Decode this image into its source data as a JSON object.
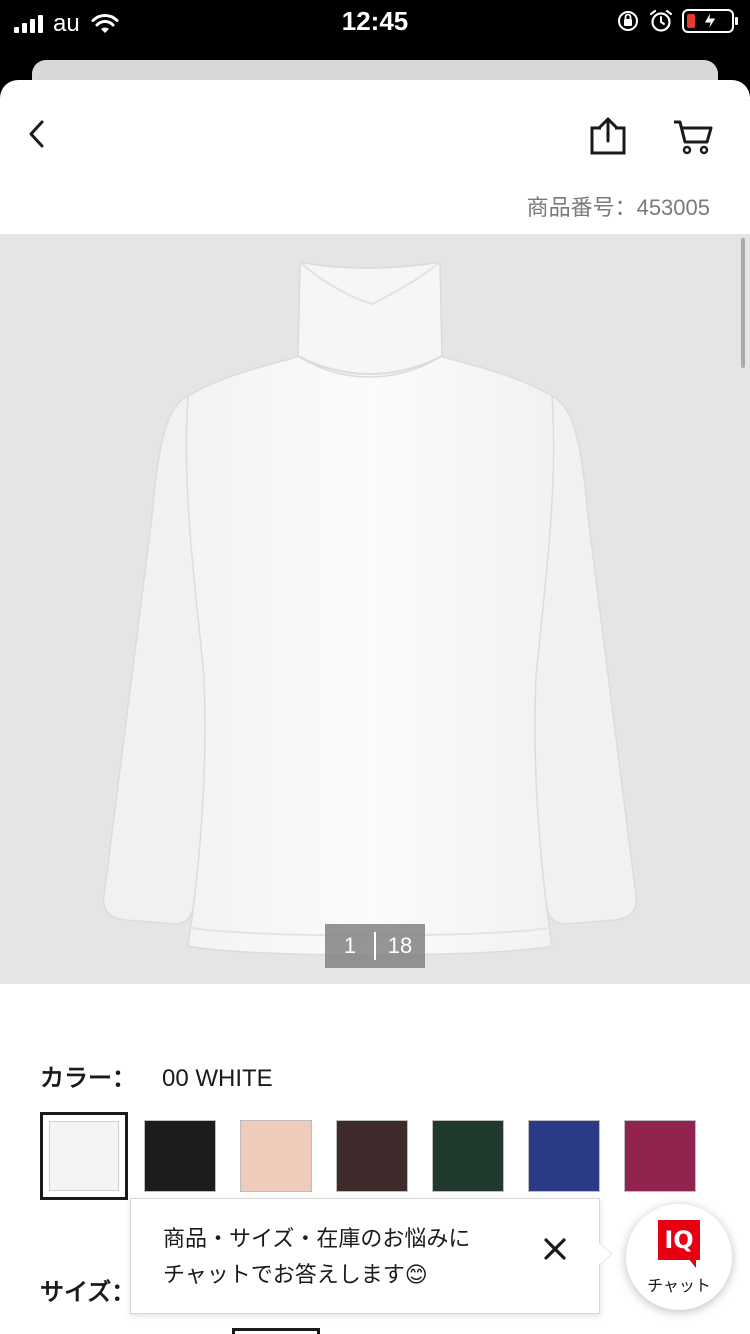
{
  "status_bar": {
    "carrier": "au",
    "time": "12:45"
  },
  "product": {
    "number_label": "商品番号：453005"
  },
  "gallery": {
    "current_index": "1",
    "total_images": "18"
  },
  "color": {
    "label": "カラー：",
    "selected_value": "00 WHITE",
    "swatches": [
      {
        "name": "white",
        "hex": "#f4f4f2"
      },
      {
        "name": "black",
        "hex": "#1c1c1e"
      },
      {
        "name": "pink",
        "hex": "#efcbbc"
      },
      {
        "name": "dark-brown",
        "hex": "#3e2a2a"
      },
      {
        "name": "dark-green",
        "hex": "#1f3a2c"
      },
      {
        "name": "blue",
        "hex": "#2a3a86"
      },
      {
        "name": "wine",
        "hex": "#92224e"
      }
    ]
  },
  "size": {
    "label": "サイズ："
  },
  "chat": {
    "message_line1": "商品・サイズ・在庫のお悩みに",
    "message_line2": "チャットでお答えします😊",
    "fab_badge": "IQ",
    "fab_label": "チャット"
  },
  "colors": {
    "accent_red": "#e60012",
    "gallery_bg": "#e5e5e6",
    "text": "#1a1a1a",
    "muted": "#7a7a7a"
  }
}
